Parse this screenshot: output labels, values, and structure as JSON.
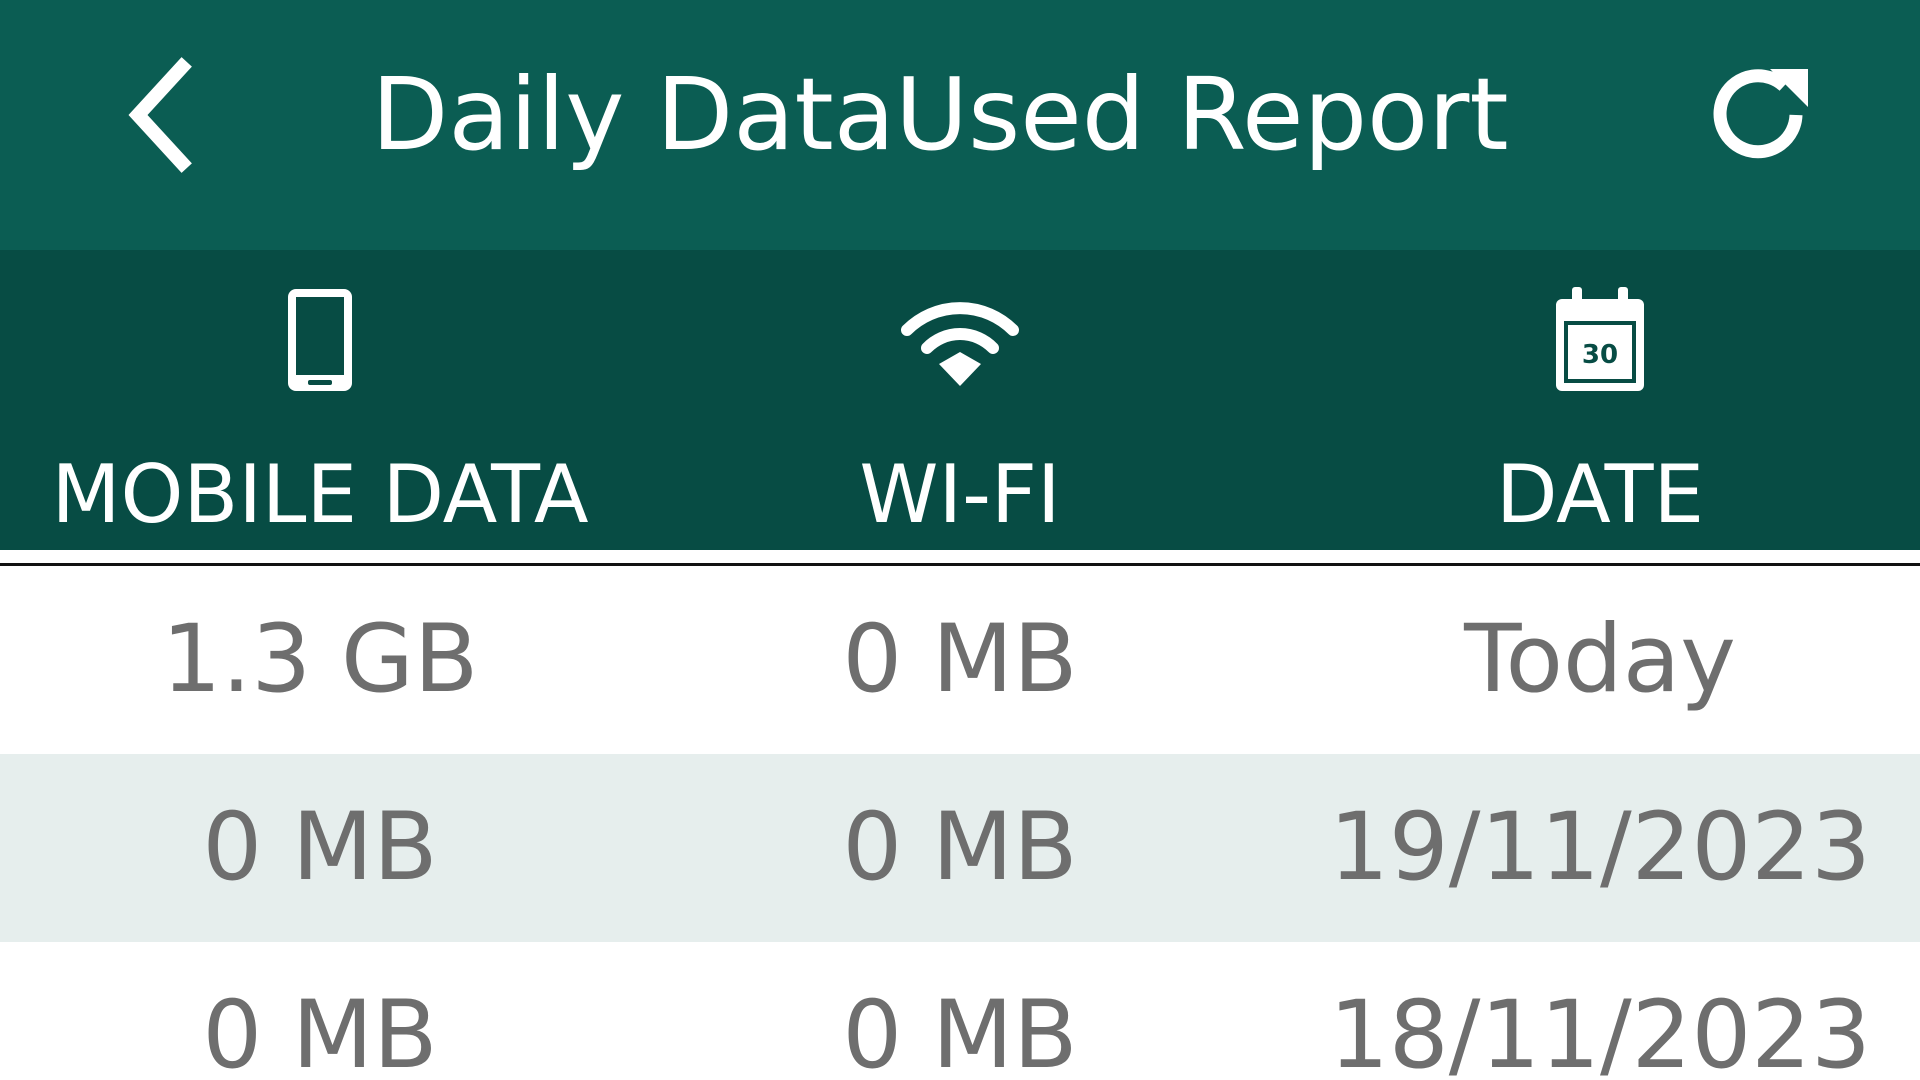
{
  "app_bar": {
    "title": "Daily DataUsed Report",
    "back_icon": "chevron-left-icon",
    "refresh_icon": "refresh-icon",
    "background": "#0b5d53"
  },
  "columns": [
    {
      "label": "MOBILE DATA",
      "icon": "smartphone-icon"
    },
    {
      "label": "WI-FI",
      "icon": "wifi-icon"
    },
    {
      "label": "DATE",
      "icon": "calendar-icon",
      "icon_text": "30"
    }
  ],
  "header_background": "#074c44",
  "rows": [
    {
      "mobile": "1.3 GB",
      "wifi": "0 MB",
      "date": "Today"
    },
    {
      "mobile": "0 MB",
      "wifi": "0 MB",
      "date": "19/11/2023"
    },
    {
      "mobile": "0 MB",
      "wifi": "0 MB",
      "date": "18/11/2023"
    }
  ],
  "colors": {
    "row_alt": "#e6eeed",
    "cell_text": "#6e6e6e"
  }
}
